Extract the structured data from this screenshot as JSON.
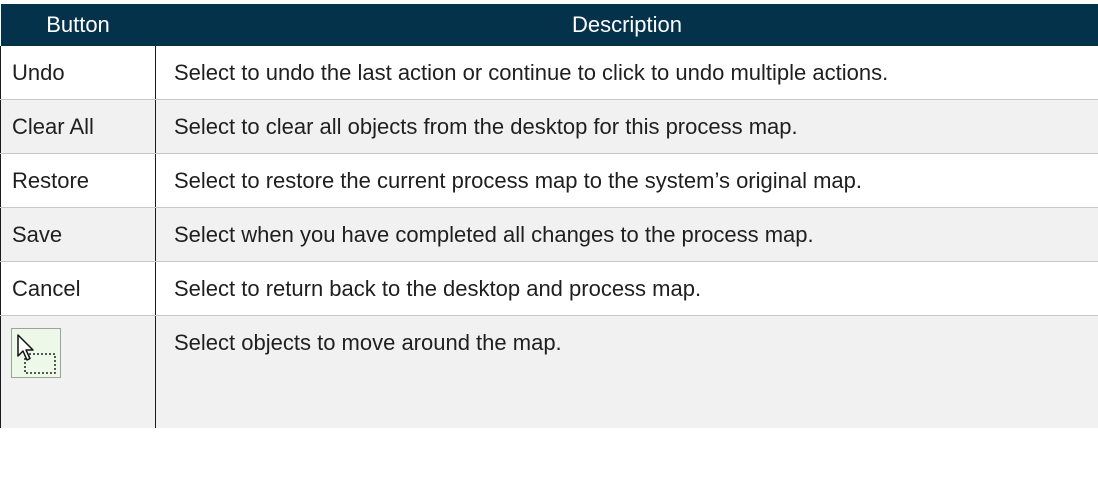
{
  "table": {
    "headers": {
      "button": "Button",
      "description": "Description"
    },
    "rows": [
      {
        "button": "Undo",
        "description": "Select to undo the last action or continue to click to undo multiple actions."
      },
      {
        "button": "Clear All",
        "description": "Select to clear all objects from the desktop for this process map."
      },
      {
        "button": "Restore",
        "description": "Select to restore the current process map to the system’s original map."
      },
      {
        "button": "Save",
        "description": "Select when you have completed all changes to the process map."
      },
      {
        "button": "Cancel",
        "description": "Select to return back to the desktop and process map."
      },
      {
        "button_icon": "select-objects-icon",
        "description": "Select objects to move around the map."
      }
    ]
  },
  "colors": {
    "header_bg": "#05324b",
    "header_text": "#ffffff",
    "row_alt_bg": "#f1f1f1",
    "icon_bg": "#edf8e8"
  }
}
